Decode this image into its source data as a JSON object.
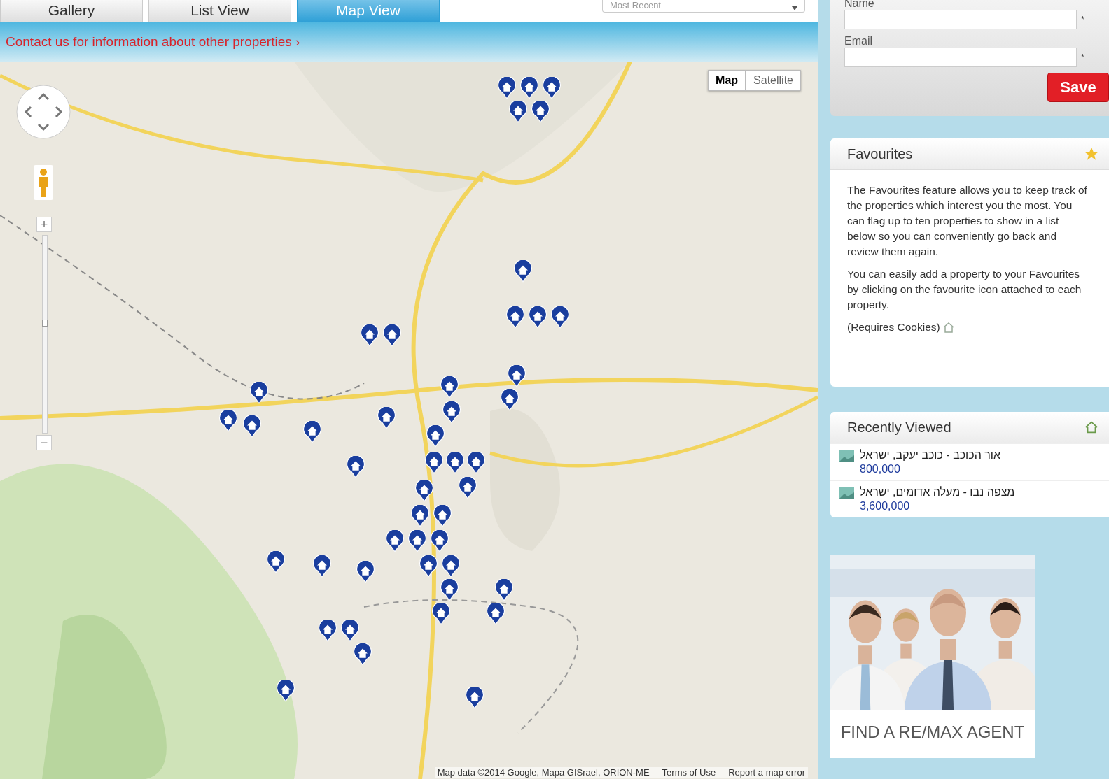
{
  "tabs": [
    {
      "label": "Gallery",
      "selected": false
    },
    {
      "label": "List View",
      "selected": false
    },
    {
      "label": "Map View",
      "selected": true
    }
  ],
  "sort": {
    "value": "Most Recent"
  },
  "banner": {
    "link": "Contact us for information about other properties",
    "chevron": "›"
  },
  "map": {
    "kind": "picture",
    "map_types": [
      {
        "label": "Map",
        "selected": true
      },
      {
        "label": "Satellite",
        "selected": false
      }
    ],
    "zoom": {
      "level": 0.56
    },
    "zoom_in": "+",
    "zoom_out": "−",
    "attribution": "Map data ©2014 Google, Mapa GISrael, ORION-ME",
    "terms": "Terms of Use",
    "report": "Report a map error"
  },
  "contact_form": {
    "fields": [
      {
        "label": "Name",
        "required_mark": "*"
      },
      {
        "label": "Email",
        "required_mark": "*"
      }
    ],
    "save": "Save"
  },
  "favourites": {
    "title": "Favourites",
    "paragraphs": [
      "The Favourites feature allows you to keep track of the properties which interest you the most.  You can flag up to ten properties to show in a list below so you can conveniently go back and review them again.",
      "You can easily add a property to your Favourites by clicking on the favourite icon attached to each property."
    ],
    "note": "(Requires Cookies)"
  },
  "recently_viewed": {
    "title": "Recently Viewed",
    "items": [
      {
        "name": "אור הכוכב - כוכב יעקב, ישראל",
        "price": "800,000"
      },
      {
        "name": "מצפה נבו - מעלה אדומים, ישראל",
        "price": "3,600,000"
      }
    ]
  },
  "ad": {
    "kind": "picture",
    "caption": "FIND A RE/MAX AGENT"
  }
}
